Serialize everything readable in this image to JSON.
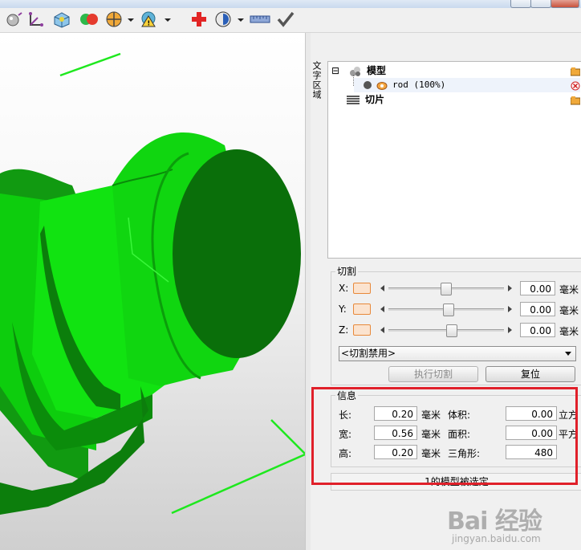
{
  "side_tab": {
    "label": "文字区域"
  },
  "tree": {
    "model_label": "模型",
    "rod_label": "rod (100%)",
    "slice_label": "切片",
    "expander": "⊟"
  },
  "cut": {
    "title": "切割",
    "x_label": "X:",
    "y_label": "Y:",
    "z_label": "Z:",
    "x_value": "0.00",
    "y_value": "0.00",
    "z_value": "0.00",
    "x_pos": 0.5,
    "y_pos": 0.52,
    "z_pos": 0.55,
    "unit": "毫米",
    "mode_selected": "<切割禁用>",
    "execute_label": "执行切割",
    "reset_label": "复位"
  },
  "info": {
    "title": "信息",
    "length_label": "长:",
    "width_label": "宽:",
    "height_label": "高:",
    "length_value": "0.20",
    "width_value": "0.56",
    "height_value": "0.20",
    "unit_mm": "毫米",
    "volume_label": "体积:",
    "area_label": "面积:",
    "triangles_label": "三角形:",
    "volume_value": "0.00",
    "area_value": "0.00",
    "triangles_value": "480",
    "volume_unit": "立方",
    "area_unit": "平方"
  },
  "status": {
    "text": "1的模型被选定"
  },
  "watermark": {
    "logo": "Bai 经验",
    "sub": "jingyan.baidu.com"
  },
  "colors": {
    "model_green": "#0fcf0f",
    "highlight_red": "#e0202a",
    "slider_orange": "#e8893a"
  }
}
